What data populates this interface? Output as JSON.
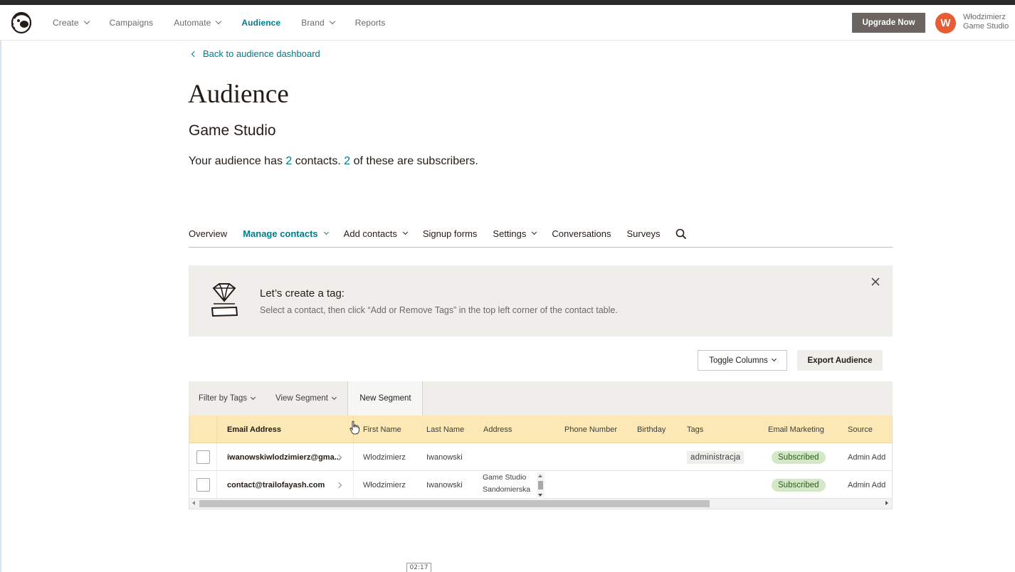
{
  "topnav": {
    "items": [
      {
        "label": "Create",
        "has_dropdown": true,
        "active": false
      },
      {
        "label": "Campaigns",
        "has_dropdown": false,
        "active": false
      },
      {
        "label": "Automate",
        "has_dropdown": true,
        "active": false
      },
      {
        "label": "Audience",
        "has_dropdown": false,
        "active": true
      },
      {
        "label": "Brand",
        "has_dropdown": true,
        "active": false
      },
      {
        "label": "Reports",
        "has_dropdown": false,
        "active": false
      }
    ],
    "upgrade_label": "Upgrade Now",
    "avatar_initial": "W",
    "user_name": "Włodzimierz",
    "user_org": "Game Studio"
  },
  "header": {
    "back_label": "Back to audience dashboard",
    "title": "Audience",
    "audience_name": "Game Studio",
    "summary_prefix": "Your audience has ",
    "contacts_count": "2",
    "summary_mid": " contacts. ",
    "subscribers_count": "2",
    "summary_suffix": " of these are subscribers."
  },
  "subtabs": [
    {
      "label": "Overview",
      "has_dropdown": false,
      "active": false
    },
    {
      "label": "Manage contacts",
      "has_dropdown": true,
      "active": true
    },
    {
      "label": "Add contacts",
      "has_dropdown": true,
      "active": false
    },
    {
      "label": "Signup forms",
      "has_dropdown": false,
      "active": false
    },
    {
      "label": "Settings",
      "has_dropdown": true,
      "active": false
    },
    {
      "label": "Conversations",
      "has_dropdown": false,
      "active": false
    },
    {
      "label": "Surveys",
      "has_dropdown": false,
      "active": false
    }
  ],
  "banner": {
    "title": "Let’s create a tag:",
    "text": "Select a contact, then click “Add or Remove Tags” in the top left corner of the contact table."
  },
  "toolbar": {
    "toggle_columns_label": "Toggle Columns",
    "export_label": "Export Audience"
  },
  "filterbar": {
    "filter_tags_label": "Filter by Tags",
    "view_segment_label": "View Segment",
    "new_segment_label": "New Segment"
  },
  "table": {
    "columns": [
      "Email Address",
      "First Name",
      "Last Name",
      "Address",
      "Phone Number",
      "Birthday",
      "Tags",
      "Email Marketing",
      "Source"
    ],
    "rows": [
      {
        "email": "iwanowskiwlodzimierz@gma...",
        "first_name": "Wlodzimierz",
        "last_name": "Iwanowski",
        "address_lines": [
          "",
          ""
        ],
        "phone": "",
        "birthday": "",
        "tag": "administracja",
        "status": "Subscribed",
        "source": "Admin Add"
      },
      {
        "email": "contact@trailofayash.com",
        "first_name": "Włodzimierz",
        "last_name": "Iwanowski",
        "address_lines": [
          "Game Studio",
          "Sandomierska"
        ],
        "phone": "",
        "birthday": "",
        "tag": "",
        "status": "Subscribed",
        "source": "Admin Add"
      }
    ]
  },
  "timer": "02:17",
  "colors": {
    "accent": "#007c89",
    "upgrade_bg": "#6b6461",
    "avatar_bg": "#e85c33",
    "table_header_bg": "#fbe8b5",
    "banner_bg": "#efeeea",
    "subscribed_bg": "#d4e8c8"
  }
}
